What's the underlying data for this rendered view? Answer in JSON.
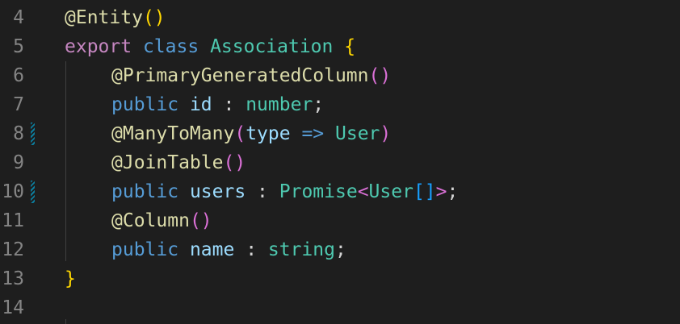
{
  "editor": {
    "lines": [
      {
        "number": "4",
        "dirty": false,
        "tokens": [
          {
            "text": "@Entity",
            "kind": "dec"
          },
          {
            "text": "()",
            "kind": "b1"
          }
        ]
      },
      {
        "number": "5",
        "dirty": false,
        "tokens": [
          {
            "text": "export",
            "kind": "kw"
          },
          {
            "text": " ",
            "kind": "txt"
          },
          {
            "text": "class",
            "kind": "sk"
          },
          {
            "text": " ",
            "kind": "txt"
          },
          {
            "text": "Association",
            "kind": "cls"
          },
          {
            "text": " ",
            "kind": "txt"
          },
          {
            "text": "{",
            "kind": "b1"
          }
        ]
      },
      {
        "number": "6",
        "dirty": false,
        "indent": true,
        "tokens": [
          {
            "text": "@PrimaryGeneratedColumn",
            "kind": "dec"
          },
          {
            "text": "()",
            "kind": "b2"
          }
        ]
      },
      {
        "number": "7",
        "dirty": false,
        "indent": true,
        "tokens": [
          {
            "text": "public",
            "kind": "sk"
          },
          {
            "text": " ",
            "kind": "txt"
          },
          {
            "text": "id",
            "kind": "vr"
          },
          {
            "text": " : ",
            "kind": "txt"
          },
          {
            "text": "number",
            "kind": "cls"
          },
          {
            "text": ";",
            "kind": "txt"
          }
        ]
      },
      {
        "number": "8",
        "dirty": true,
        "indent": true,
        "tokens": [
          {
            "text": "@ManyToMany",
            "kind": "dec"
          },
          {
            "text": "(",
            "kind": "b2"
          },
          {
            "text": "type",
            "kind": "vr"
          },
          {
            "text": " ",
            "kind": "txt"
          },
          {
            "text": "=>",
            "kind": "sk"
          },
          {
            "text": " ",
            "kind": "txt"
          },
          {
            "text": "User",
            "kind": "cls"
          },
          {
            "text": ")",
            "kind": "b2"
          }
        ]
      },
      {
        "number": "9",
        "dirty": false,
        "indent": true,
        "tokens": [
          {
            "text": "@JoinTable",
            "kind": "dec"
          },
          {
            "text": "()",
            "kind": "b2"
          }
        ]
      },
      {
        "number": "10",
        "dirty": true,
        "indent": true,
        "tokens": [
          {
            "text": "public",
            "kind": "sk"
          },
          {
            "text": " ",
            "kind": "txt"
          },
          {
            "text": "users",
            "kind": "vr"
          },
          {
            "text": " : ",
            "kind": "txt"
          },
          {
            "text": "Promise",
            "kind": "cls"
          },
          {
            "text": "<",
            "kind": "b2"
          },
          {
            "text": "User",
            "kind": "cls"
          },
          {
            "text": "[]",
            "kind": "b3"
          },
          {
            "text": ">",
            "kind": "b2"
          },
          {
            "text": ";",
            "kind": "txt"
          }
        ]
      },
      {
        "number": "11",
        "dirty": false,
        "indent": true,
        "tokens": [
          {
            "text": "@Column",
            "kind": "dec"
          },
          {
            "text": "()",
            "kind": "b2"
          }
        ]
      },
      {
        "number": "12",
        "dirty": false,
        "indent": true,
        "tokens": [
          {
            "text": "public",
            "kind": "sk"
          },
          {
            "text": " ",
            "kind": "txt"
          },
          {
            "text": "name",
            "kind": "vr"
          },
          {
            "text": " : ",
            "kind": "txt"
          },
          {
            "text": "string",
            "kind": "cls"
          },
          {
            "text": ";",
            "kind": "txt"
          }
        ]
      },
      {
        "number": "13",
        "dirty": false,
        "tokens": [
          {
            "text": "}",
            "kind": "b1"
          }
        ]
      },
      {
        "number": "14",
        "dirty": false,
        "tokens": []
      }
    ]
  }
}
